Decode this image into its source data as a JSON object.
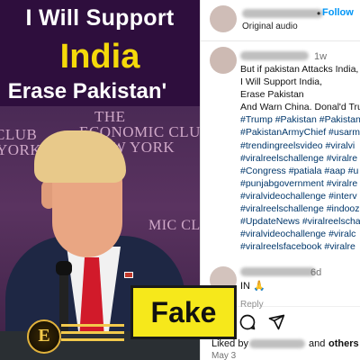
{
  "video": {
    "headline_line1": "I Will Support",
    "headline_line2": "India",
    "headline_line3": "Erase Pakistan'",
    "backdrop_sign_lines": [
      "THE",
      "ECONOMIC CLUB",
      "NEW YORK",
      "CLUB",
      "YORK",
      "MIC CLUB"
    ],
    "logo_letter": "E",
    "verdict_badge": "Fake"
  },
  "post": {
    "follow_label": "Follow",
    "follow_separator": "•",
    "audio_label": "Original audio",
    "caption_time": "1w",
    "caption_lines": [
      {
        "text": "But if pakistan Attacks India,",
        "tag": false
      },
      {
        "text": "I Will Support India,",
        "tag": false
      },
      {
        "text": "Erase Pakistan",
        "tag": false
      },
      {
        "text": "And Warn China. Donal'd Tru",
        "tag": false
      },
      {
        "text": "#Trump #Pakistan #Pakistan",
        "tag": true
      },
      {
        "text": "#PakistanArmyChief #usarm",
        "tag": true
      },
      {
        "text": "#trendingreelsvideo #viralvi",
        "tag": true
      },
      {
        "text": "#viralreelschallenge #viralre",
        "tag": true
      },
      {
        "text": "#Congress #patiala #aap #u",
        "tag": true
      },
      {
        "text": "#punjabgovernment #viralre",
        "tag": true
      },
      {
        "text": "#viralvideochallenge #interv",
        "tag": true
      },
      {
        "text": "#viralreelschallenge #indooz",
        "tag": true
      },
      {
        "text": "#UpdateNews #viralreelschal",
        "tag": true
      },
      {
        "text": "#viralvideochallenge #viralc",
        "tag": true
      },
      {
        "text": "#viralreelsfacebook #viralre",
        "tag": true
      }
    ],
    "comment": {
      "time": "6d",
      "text": "IN 🙏",
      "reply_label": "Reply"
    },
    "icons": [
      "comment-icon",
      "share-icon"
    ],
    "liked_prefix": "Liked by",
    "liked_and": "and",
    "liked_others": "others",
    "date": "May 3",
    "colors": {
      "link": "#0095f6",
      "hashtag": "#00376b",
      "badge": "#f6e81b",
      "headline_accent": "#f5d90a"
    }
  }
}
